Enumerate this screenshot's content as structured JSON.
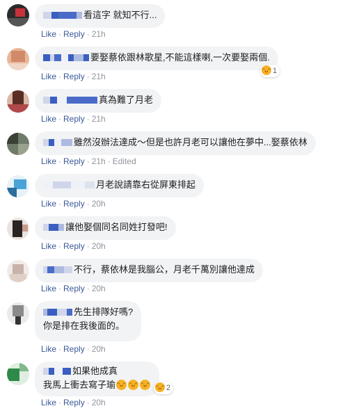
{
  "comments": [
    {
      "text": "看這字 就知不行...",
      "link_like": "Like",
      "link_reply": "Reply",
      "time": "21h"
    },
    {
      "text": "要娶蔡依跟林歌星,不能這樣喇,一次要娶兩個.",
      "link_like": "Like",
      "link_reply": "Reply",
      "time": "21h",
      "reaction_count": "1"
    },
    {
      "text": "真為難了月老",
      "link_like": "Like",
      "link_reply": "Reply",
      "time": "21h"
    },
    {
      "text": "雖然沒辦法達成～但是也許月老可以讓他在夢中...娶蔡依林",
      "link_like": "Like",
      "link_reply": "Reply",
      "time": "21h",
      "edited": "Edited"
    },
    {
      "text": "月老說請靠右從屏東排起",
      "link_like": "Like",
      "link_reply": "Reply",
      "time": "20h"
    },
    {
      "text": "讓他娶個同名同姓打發吧!",
      "link_like": "Like",
      "link_reply": "Reply",
      "time": "20h"
    },
    {
      "text": "不行，蔡依林是我腦公，月老千萬別讓他達成",
      "link_like": "Like",
      "link_reply": "Reply",
      "time": "20h"
    },
    {
      "text": "先生排隊好嗎?",
      "text2": "你是排在我後面的。",
      "link_like": "Like",
      "link_reply": "Reply",
      "time": "20h"
    },
    {
      "text": "如果他成真",
      "text2": "我馬上衝去寫子瑜",
      "link_like": "Like",
      "link_reply": "Reply",
      "time": "20h",
      "reaction_count": "2"
    }
  ],
  "icons": {
    "haha": "haha-emoji-icon",
    "laugh": "rofl-emoji-icon"
  },
  "colors": {
    "link": "#385898",
    "meta": "#90949c",
    "bubble": "#f2f3f5",
    "name_blur": "#3b5fc0",
    "haha": "#f7b125"
  }
}
